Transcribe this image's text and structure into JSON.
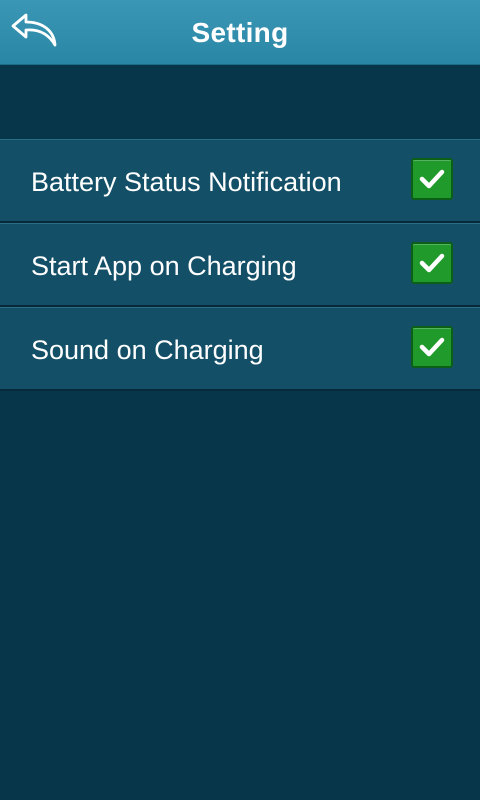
{
  "header": {
    "title": "Setting",
    "back_icon": "back-arrow-icon"
  },
  "settings": {
    "items": [
      {
        "label": "Battery Status Notification",
        "checked": true
      },
      {
        "label": "Start App on Charging",
        "checked": true
      },
      {
        "label": "Sound on Charging",
        "checked": true
      }
    ]
  },
  "colors": {
    "header": "#3190ae",
    "background": "#07354a",
    "row": "#134f67",
    "checkbox": "#219a2c"
  }
}
